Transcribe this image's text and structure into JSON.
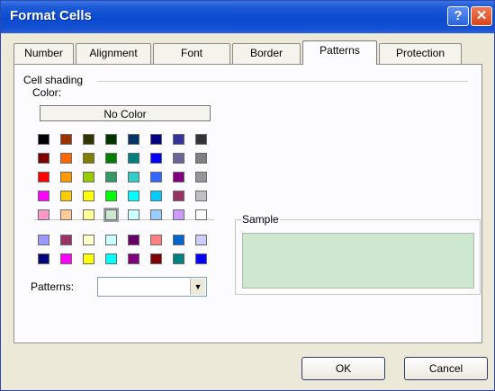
{
  "dialog": {
    "title": "Format Cells",
    "help_label": "?",
    "close_label": "✕"
  },
  "tabs": [
    {
      "label": "Number",
      "selected": false
    },
    {
      "label": "Alignment",
      "selected": false
    },
    {
      "label": "Font",
      "selected": false
    },
    {
      "label": "Border",
      "selected": false
    },
    {
      "label": "Patterns",
      "selected": true
    },
    {
      "label": "Protection",
      "selected": false
    }
  ],
  "shading": {
    "group_label": "Cell shading",
    "color_label": "Color:",
    "no_color_label": "No Color",
    "selected_color": "#cde8cf",
    "palette_rows": [
      [
        "#000000",
        "#993300",
        "#333300",
        "#003300",
        "#003366",
        "#000080",
        "#333399",
        "#333333"
      ],
      [
        "#800000",
        "#ff6600",
        "#808000",
        "#008000",
        "#008080",
        "#0000ff",
        "#666699",
        "#808080"
      ],
      [
        "#ff0000",
        "#ff9900",
        "#99cc00",
        "#339966",
        "#33cccc",
        "#3366ff",
        "#800080",
        "#969696"
      ],
      [
        "#ff00ff",
        "#ffcc00",
        "#ffff00",
        "#00ff00",
        "#00ffff",
        "#00ccff",
        "#993366",
        "#c0c0c0"
      ],
      [
        "#ff99cc",
        "#ffcc99",
        "#ffff99",
        "#cde8cf",
        "#ccffff",
        "#99ccff",
        "#cc99ff",
        "#ffffff"
      ]
    ],
    "chart_palette_rows": [
      [
        "#9999ff",
        "#993366",
        "#ffffcc",
        "#ccffff",
        "#660066",
        "#ff8080",
        "#0066cc",
        "#ccccff"
      ],
      [
        "#000080",
        "#ff00ff",
        "#ffff00",
        "#00ffff",
        "#800080",
        "#800000",
        "#008080",
        "#0000ff"
      ]
    ]
  },
  "patterns": {
    "label": "Patterns:",
    "value": ""
  },
  "sample": {
    "label": "Sample",
    "color": "#cde8cf"
  },
  "buttons": {
    "ok_label": "OK",
    "cancel_label": "Cancel"
  }
}
